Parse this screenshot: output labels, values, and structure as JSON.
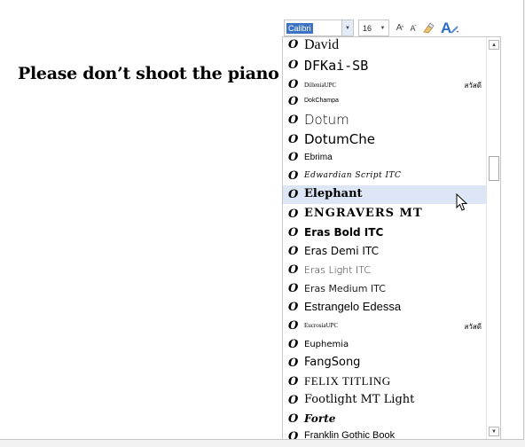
{
  "document": {
    "text": "Please don’t shoot the piano"
  },
  "mini_toolbar": {
    "font_name": "Calibri",
    "font_size": "16",
    "grow_label": "A",
    "shrink_label": "A",
    "styles_label": "A"
  },
  "font_list": {
    "items": [
      {
        "name": "David",
        "sample": ""
      },
      {
        "name": "DFKai-SB",
        "sample": ""
      },
      {
        "name": "DilleniaUPC",
        "sample": "สวัสดี"
      },
      {
        "name": "DokChampa",
        "sample": ""
      },
      {
        "name": "Dotum",
        "sample": ""
      },
      {
        "name": "DotumChe",
        "sample": ""
      },
      {
        "name": "Ebrima",
        "sample": ""
      },
      {
        "name": "Edwardian Script ITC",
        "sample": ""
      },
      {
        "name": "Elephant",
        "sample": ""
      },
      {
        "name": "ENGRAVERS MT",
        "sample": ""
      },
      {
        "name": "Eras Bold ITC",
        "sample": ""
      },
      {
        "name": "Eras Demi ITC",
        "sample": ""
      },
      {
        "name": "Eras Light ITC",
        "sample": ""
      },
      {
        "name": "Eras Medium ITC",
        "sample": ""
      },
      {
        "name": "Estrangelo Edessa",
        "sample": ""
      },
      {
        "name": "EucrosiaUPC",
        "sample": "สวัสดี"
      },
      {
        "name": "Euphemia",
        "sample": ""
      },
      {
        "name": "FangSong",
        "sample": ""
      },
      {
        "name": "FELIX TITLING",
        "sample": ""
      },
      {
        "name": "Footlight MT Light",
        "sample": ""
      },
      {
        "name": "Forte",
        "sample": ""
      },
      {
        "name": "Franklin Gothic Book",
        "sample": ""
      }
    ],
    "highlighted": "Elephant"
  },
  "icons": {
    "font_type": "opentype-font-icon",
    "grow": "grow-font-icon",
    "shrink": "shrink-font-icon",
    "clear": "clear-formatting-icon",
    "styles": "styles-icon",
    "cursor": "mouse-pointer-icon"
  },
  "colors": {
    "highlight": "#dde6f4",
    "selection": "#3d73c5",
    "styles_accent": "#2b6cc4"
  }
}
